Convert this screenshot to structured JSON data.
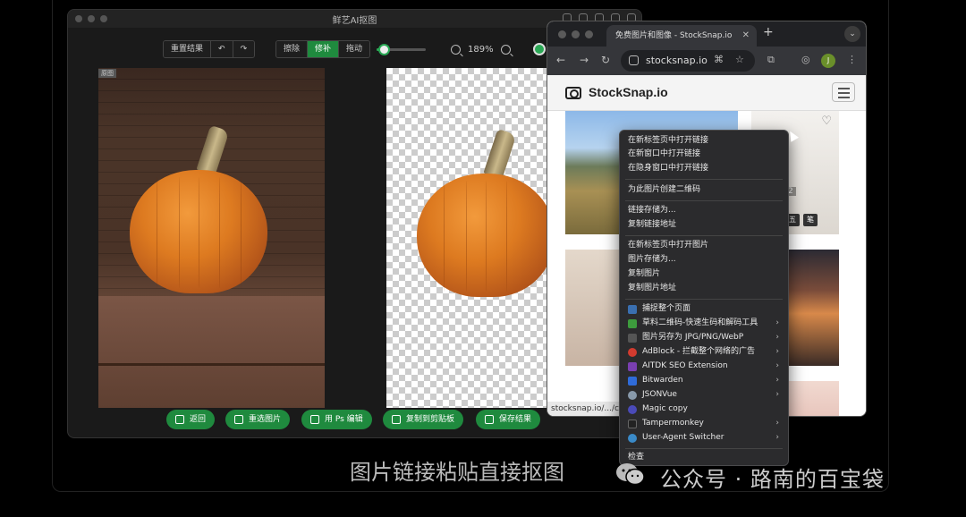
{
  "app": {
    "title": "鲜艺AI抠图",
    "toolbar": {
      "reset_label": "重置结果",
      "undo_icon": "undo-icon",
      "redo_icon": "redo-icon",
      "mode_erase": "擦除",
      "mode_repair": "修补",
      "mode_drag": "拖动",
      "brush_size_percent": 15,
      "zoom_level": "189%"
    },
    "original_tag": "原图",
    "actions": {
      "back": "返回",
      "reselect": "重选图片",
      "ps_edit": "用 Ps 编辑",
      "copy_clipboard": "复制到剪贴板",
      "save": "保存结果"
    },
    "accent_color": "#1f8a3e"
  },
  "browser": {
    "tab_title": "免费图片和图像 - StockSnap.io",
    "new_tab": "+",
    "address": "stocksnap.io",
    "avatar_letter": "J",
    "site_name": "StockSnap.io",
    "status_url": "stocksnap.io/.../cof",
    "likes": "2",
    "chip_a": "五",
    "chip_b": "笔"
  },
  "context_menu": {
    "group1": [
      "在新标签页中打开链接",
      "在新窗口中打开链接",
      "在隐身窗口中打开链接"
    ],
    "group2": [
      "为此图片创建二维码"
    ],
    "group3": [
      "链接存储为...",
      "复制链接地址"
    ],
    "group4": [
      "在新标签页中打开图片",
      "图片存储为...",
      "复制图片",
      "复制图片地址"
    ],
    "extensions": [
      {
        "label": "捕捉整个页面",
        "submenu": false
      },
      {
        "label": "草料二维码-快速生码和解码工具",
        "submenu": true
      },
      {
        "label": "图片另存为 JPG/PNG/WebP",
        "submenu": true
      },
      {
        "label": "AdBlock - 拦截整个网络的广告",
        "submenu": true
      },
      {
        "label": "AITDK SEO Extension",
        "submenu": true
      },
      {
        "label": "Bitwarden",
        "submenu": true
      },
      {
        "label": "JSONVue",
        "submenu": true
      },
      {
        "label": "Magic copy",
        "submenu": false
      },
      {
        "label": "Tampermonkey",
        "submenu": true
      },
      {
        "label": "User-Agent Switcher",
        "submenu": true
      }
    ],
    "inspect": "检查"
  },
  "caption": "图片链接粘贴直接抠图",
  "watermark": "公众号 · 路南的百宝袋"
}
